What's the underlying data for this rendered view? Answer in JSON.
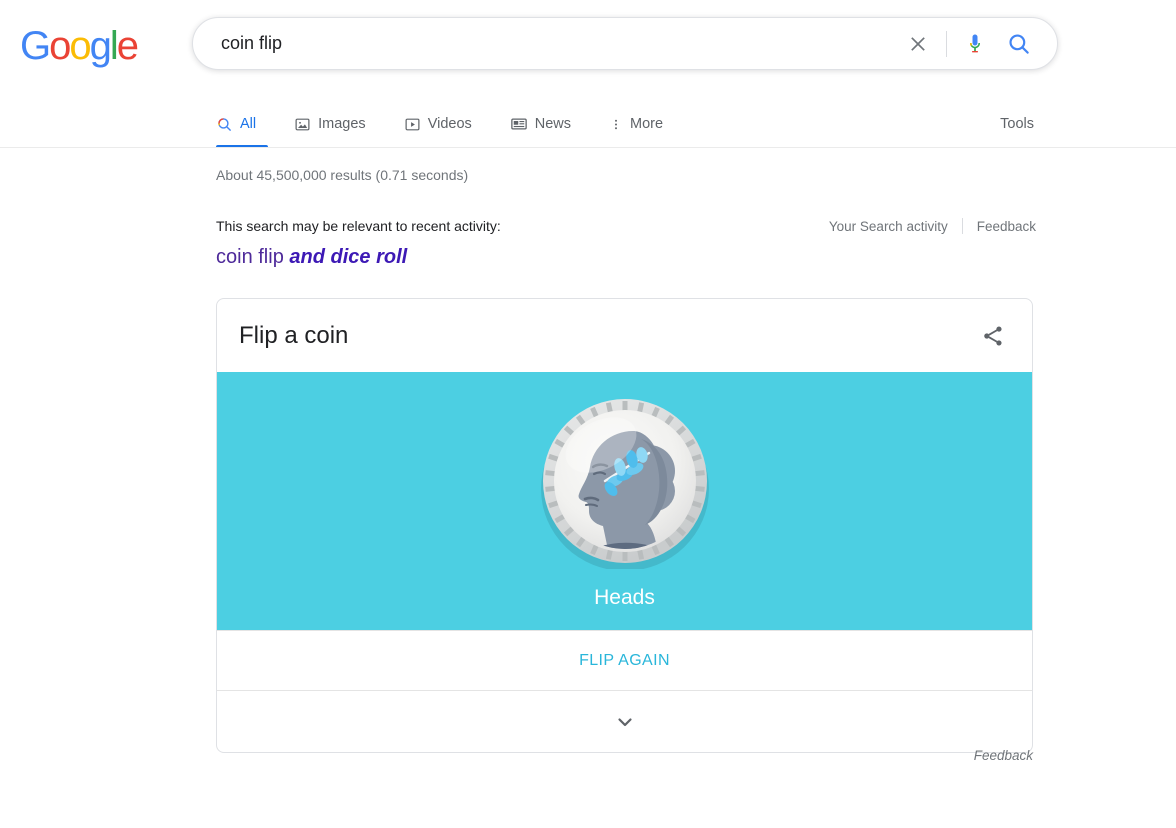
{
  "brand": {
    "logo_letters": [
      {
        "char": "G",
        "color": "#4285F4"
      },
      {
        "char": "o",
        "color": "#EA4335"
      },
      {
        "char": "o",
        "color": "#FBBC05"
      },
      {
        "char": "g",
        "color": "#4285F4"
      },
      {
        "char": "l",
        "color": "#34A853"
      },
      {
        "char": "e",
        "color": "#EA4335"
      }
    ],
    "logo_text": "Google"
  },
  "search": {
    "value": "coin flip",
    "placeholder": "Search",
    "clear_label": "Clear",
    "voice_label": "Search by voice",
    "submit_label": "Google Search"
  },
  "nav": {
    "tabs": [
      {
        "label": "All",
        "icon": "search-icon",
        "active": true
      },
      {
        "label": "Images",
        "icon": "image-icon",
        "active": false
      },
      {
        "label": "Videos",
        "icon": "video-icon",
        "active": false
      },
      {
        "label": "News",
        "icon": "news-icon",
        "active": false
      },
      {
        "label": "More",
        "icon": "more-vert-icon",
        "active": false
      }
    ],
    "tools_label": "Tools"
  },
  "results": {
    "stats": "About 45,500,000 results (0.71 seconds)",
    "activity_note": "This search may be relevant to recent activity:",
    "activity_query_plain": "coin flip ",
    "activity_query_bold": "and dice roll",
    "search_activity_link": "Your Search activity",
    "feedback_link": "Feedback"
  },
  "coin_card": {
    "title": "Flip a coin",
    "share_label": "Share",
    "result": "Heads",
    "flip_again_label": "FLIP AGAIN",
    "expand_label": "Show more",
    "feedback_label": "Feedback",
    "stage_color": "#4ccfe2",
    "accent_color": "#29b6da",
    "coin_face": "heads",
    "coin_figure": "woman-profile-with-laurel"
  }
}
